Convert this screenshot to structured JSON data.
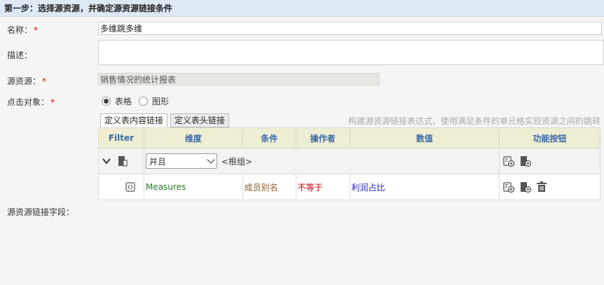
{
  "header": {
    "title": "第一步：选择源资源，并确定源资源链接条件"
  },
  "form": {
    "name": {
      "label": "名称：",
      "required_mark": "*",
      "value": "多维跳多维"
    },
    "description": {
      "label": "描述：",
      "value": ""
    },
    "source": {
      "label": "源资源：",
      "required_mark": "*",
      "value": "销售情况的统计报表"
    },
    "click_target": {
      "label": "点击对象：",
      "required_mark": "*",
      "options": [
        {
          "label": "表格",
          "checked": true
        },
        {
          "label": "图形",
          "checked": false
        }
      ]
    },
    "link_fields": {
      "label": "源资源链接字段："
    }
  },
  "tabs": [
    {
      "label": "定义表内容链接",
      "active": true
    },
    {
      "label": "定义表头链接",
      "active": false
    }
  ],
  "hint": "构建源资源链接表达式，使用满足条件的单元格实现资源之间的跳转",
  "grid": {
    "columns": [
      "Filter",
      "维度",
      "条件",
      "操作者",
      "数值",
      "功能按钮"
    ],
    "group_row": {
      "logic_value": "并且",
      "root_label": "<根组>"
    },
    "condition_rows": [
      {
        "dimension": "Measures",
        "condition": "成员别名",
        "operator": "不等于",
        "value": "利润占比"
      }
    ]
  },
  "colors": {
    "header_bg": "#dde9f5",
    "table_header_bg": "#eeeed4",
    "table_header_text": "#3a6aa8",
    "required": "#e00000",
    "dimension_text": "#2a7a2a",
    "condition_text": "#8a5a2b",
    "operator_text": "#c00000",
    "value_text": "#2222cc"
  },
  "icons": [
    "collapse-chevron-icon",
    "group-node-icon",
    "add-condition-icon",
    "add-group-icon",
    "condition-node-icon",
    "delete-icon"
  ]
}
